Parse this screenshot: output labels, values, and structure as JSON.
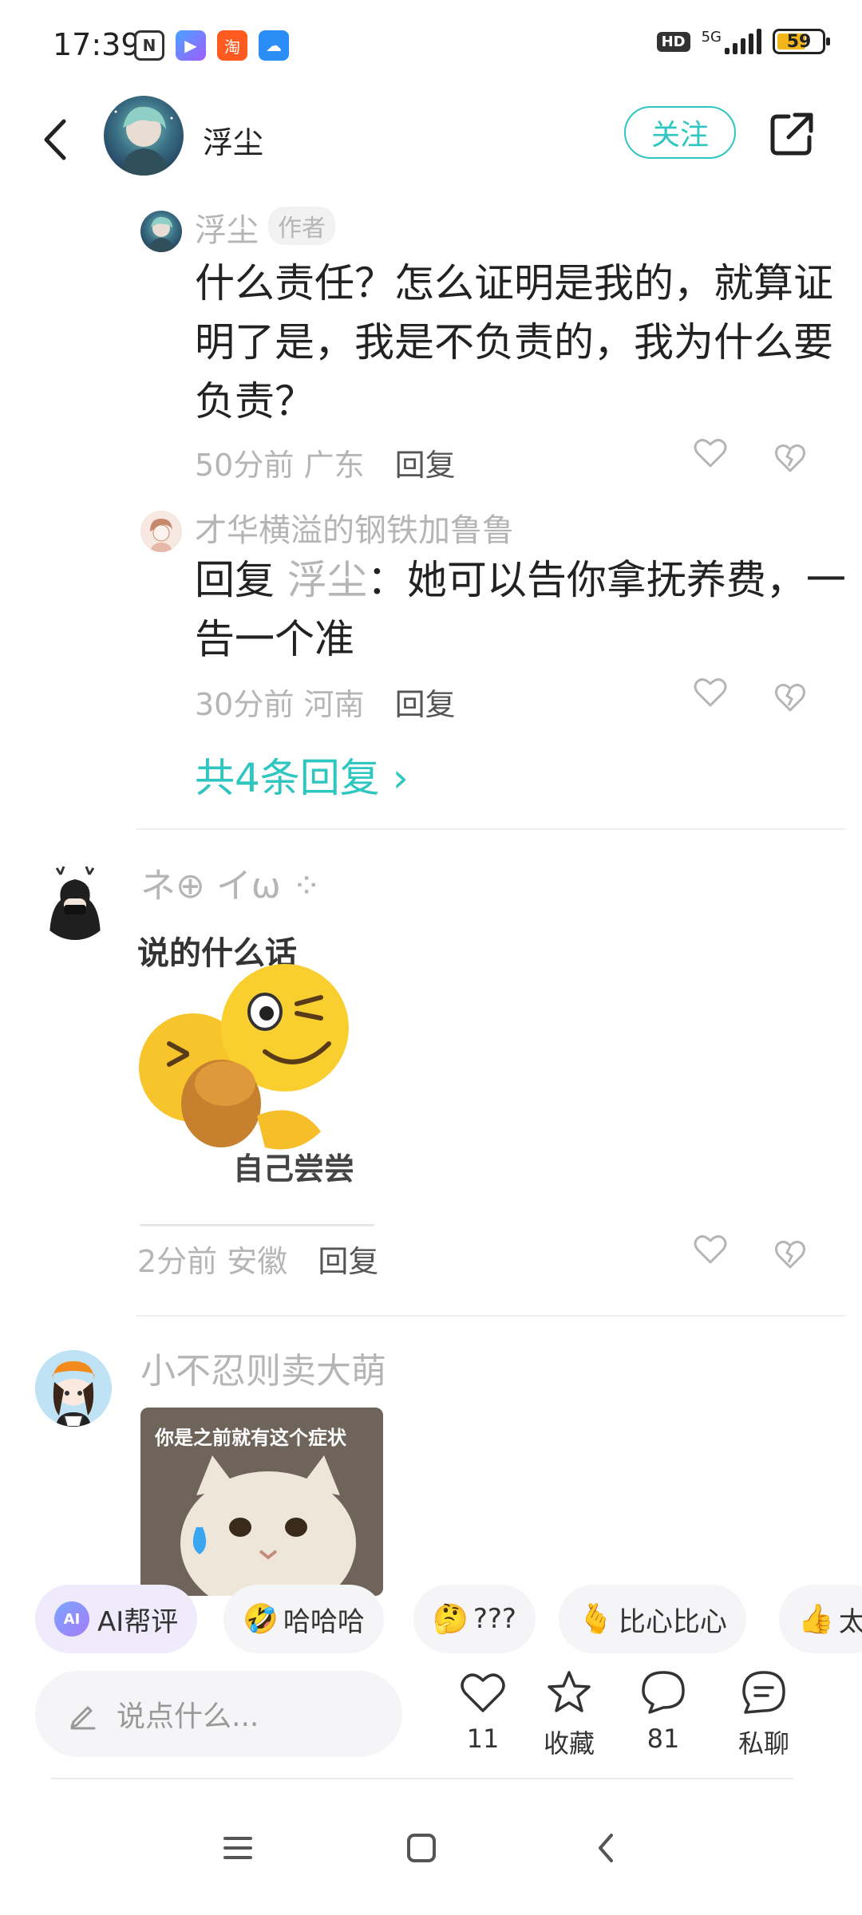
{
  "status_bar": {
    "time": "17:39",
    "hd": "HD",
    "network": "5G",
    "battery": "59",
    "battery_level": 0.59
  },
  "header": {
    "user_name": "浮尘",
    "follow_label": "关注"
  },
  "replies": [
    {
      "author": "浮尘",
      "tag": "作者",
      "text": "什么责任？怎么证明是我的，就算证明了是，我是不负责的，我为什么要负责？",
      "time": "50分前",
      "location": "广东",
      "reply_label": "回复"
    },
    {
      "author": "才华横溢的钢铁加鲁鲁",
      "reply_prefix": "回复",
      "mention": "浮尘",
      "text": "：她可以告你拿抚养费，一告一个准",
      "time": "30分前",
      "location": "河南",
      "reply_label": "回复"
    }
  ],
  "more_replies": "共4条回复 ›",
  "comments": [
    {
      "author": "ネ⊕ イω ⁘",
      "sticker_top_text": "说的什么话",
      "sticker_bottom_text": "自己尝尝",
      "time": "2分前",
      "location": "安徽",
      "reply_label": "回复"
    },
    {
      "author": "小不忍则卖大萌",
      "sticker_top_text": "你是之前就有这个症状"
    }
  ],
  "quick_reactions": [
    {
      "label": "AI帮评",
      "icon": "AI"
    },
    {
      "label": "哈哈哈",
      "icon": "🤣"
    },
    {
      "label": "???",
      "icon": "🤔"
    },
    {
      "label": "比心比心",
      "icon": "🫰"
    },
    {
      "label": "太",
      "icon": "👍"
    }
  ],
  "bottom_bar": {
    "input_placeholder": "说点什么...",
    "like_count": "11",
    "favorite_label": "收藏",
    "comment_count": "81",
    "chat_label": "私聊"
  },
  "colors": {
    "accent": "#2fc6c0",
    "muted_text": "#b5b5b5",
    "battery": "#f2b51a"
  }
}
